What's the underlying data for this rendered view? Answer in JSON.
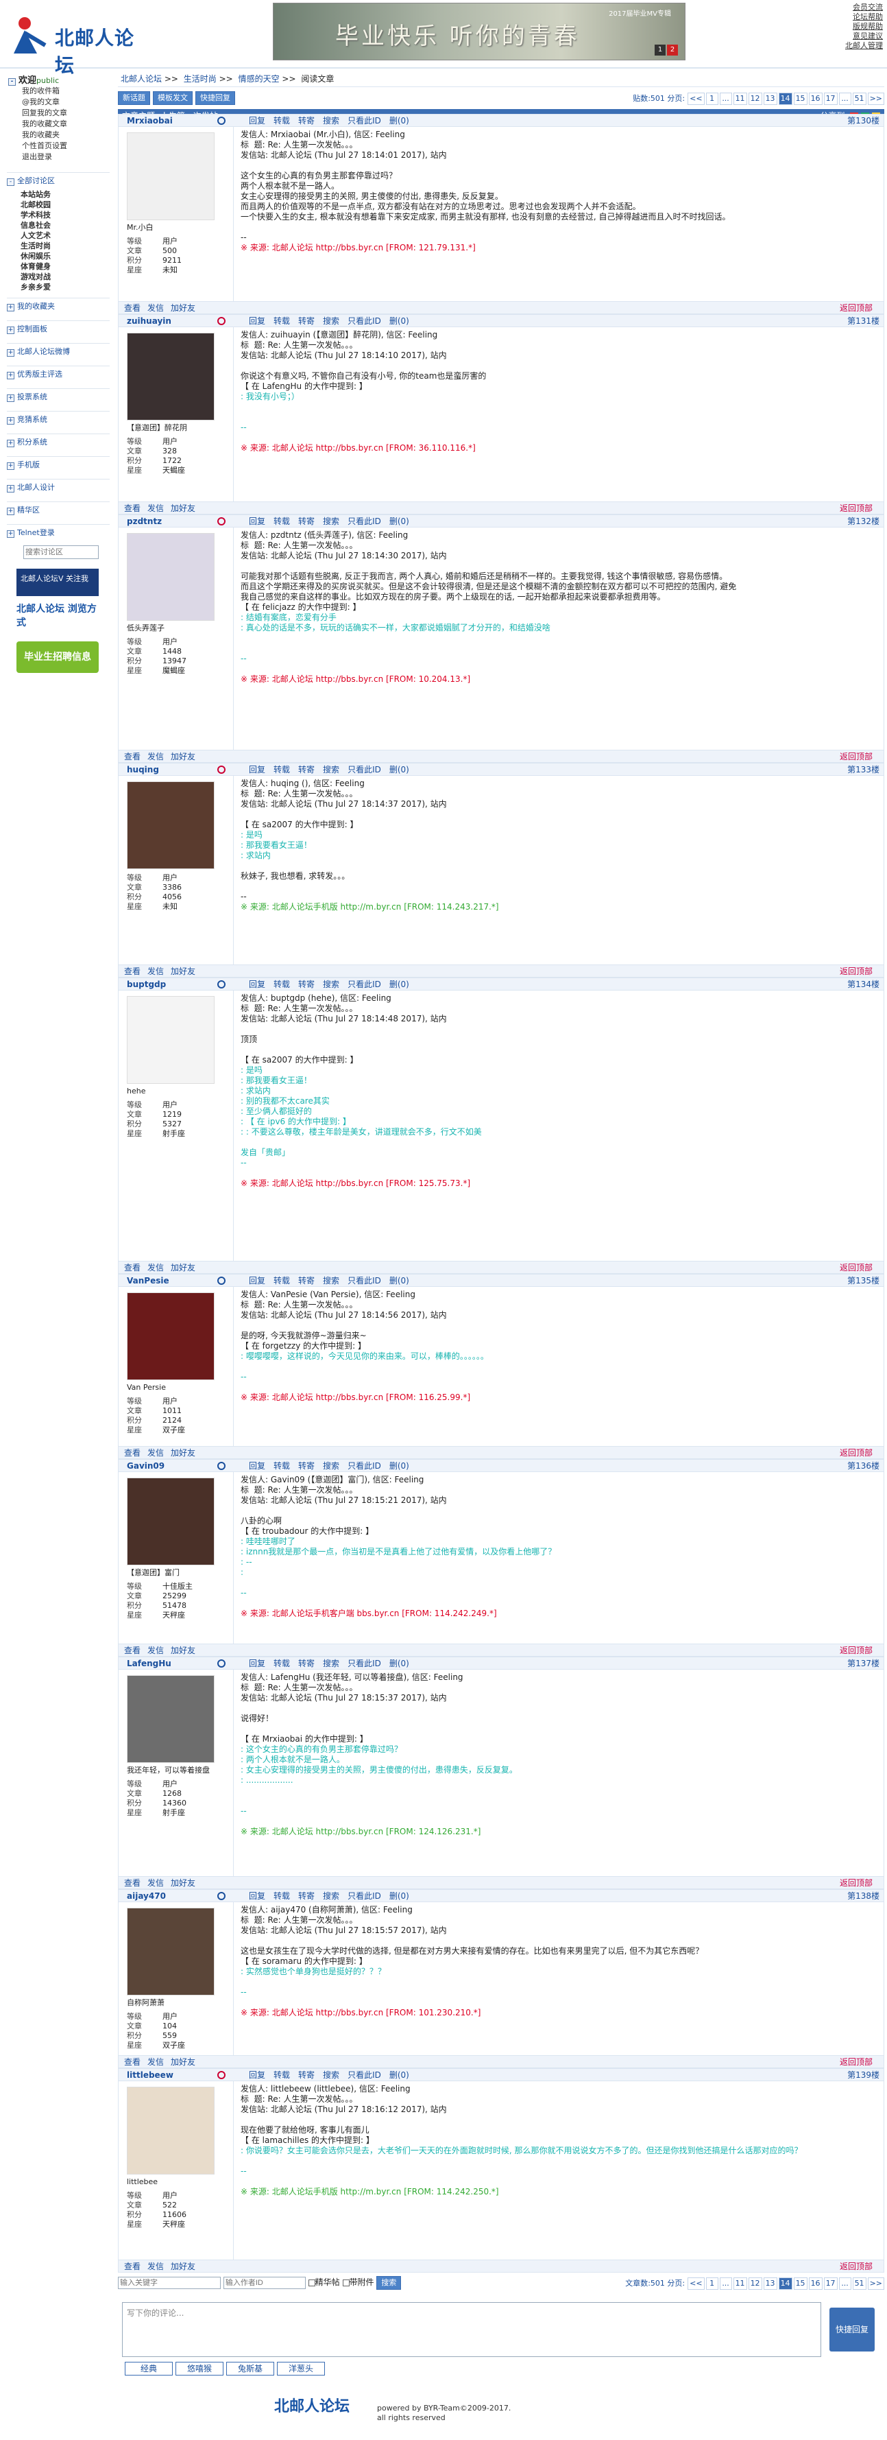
{
  "site": {
    "logo": "北邮人论坛",
    "banner_slogan": "毕业快乐 听你的青春",
    "banner_sub": "2017届毕业MV专辑",
    "banner_pages": [
      "1",
      "2"
    ]
  },
  "toplinks": [
    "会员交流",
    "论坛帮助",
    "版规帮助",
    "意见建议",
    "北邮人管理"
  ],
  "sidebar": {
    "welcome": "欢迎",
    "user": "public",
    "user_links": [
      "我的收件箱",
      "@我的文章",
      "回复我的文章",
      "我的收藏文章",
      "我的收藏夹",
      "个性首页设置",
      "退出登录"
    ],
    "all_sections": "全部讨论区",
    "boards": [
      "本站站务",
      "北邮校园",
      "学术科技",
      "信息社会",
      "人文艺术",
      "生活时尚",
      "休闲娱乐",
      "体育健身",
      "游戏对战",
      "乡亲乡爱"
    ],
    "sections": [
      "我的收藏夹",
      "控制面板",
      "北邮人论坛微博",
      "优秀版主评选",
      "投票系统",
      "竞猜系统",
      "积分系统",
      "手机版",
      "北邮人设计",
      "精华区",
      "Telnet登录"
    ],
    "search_placeholder": "搜索讨论区",
    "ad1": "北邮人论坛V 关注我",
    "ad2": "北邮人论坛 浏览方式",
    "ad3": "毕业生招聘信息"
  },
  "crumb": [
    "北邮人论坛",
    ">>",
    "生活时尚",
    ">>",
    "情感的天空",
    ">>",
    "阅读文章"
  ],
  "toolbar": {
    "new": "新话题",
    "mode": "模板发文",
    "quick": "快捷回复",
    "count_label": "贴数:501  分页:"
  },
  "pager": [
    "<<",
    "1",
    "...",
    "11",
    "12",
    "13",
    "14",
    "15",
    "16",
    "17",
    "...",
    "51",
    ">>"
  ],
  "pager_current": "14",
  "topic": {
    "label": "文章主题: 人生第一次发帖。。。",
    "share": "分享到:"
  },
  "actions": [
    "回复",
    "转载",
    "转寄",
    "搜索",
    "只看此ID",
    "删(0)"
  ],
  "foot_actions": [
    "查看",
    "发信",
    "加好友"
  ],
  "foot_top": "返回顶部",
  "posts": [
    {
      "user": "Mrxiaobai",
      "gender": "m",
      "floor": "第130楼",
      "title": "Mr.小白",
      "stats": [
        [
          "等级",
          "用户"
        ],
        [
          "文章",
          "500"
        ],
        [
          "积分",
          "9211"
        ],
        [
          "星座",
          "未知"
        ]
      ],
      "body": [
        [
          "",
          "发信人: Mrxiaobai (Mr.小白), 信区: Feeling\n标  题: Re: 人生第一次发帖。。。\n发信站: 北邮人论坛 (Thu Jul 27 18:14:01 2017), 站内\n\n这个女生的心真的有负男主那套停靠过吗？\n两个人根本就不是一路人。\n女主心安理得的接受男主的关照, 男主傻傻的付出, 患得患失, 反反复复。\n而且两人的价值观等的不是一点半点, 双方都没有站在对方的立场思考过。思考过也会发现两个人并不会适配。\n一个快要入生的女主, 根本就没有想着靠下来安定成家, 而男主就没有那样, 也没有刻意的去经营过, 自己掉得越进而且入时不时找回话。\n\n--\n"
        ],
        [
          "src",
          "※ 来源: 北邮人论坛 http://bbs.byr.cn [FROM: 121.79.131.*]"
        ]
      ]
    },
    {
      "user": "zuihuayin",
      "gender": "f",
      "floor": "第131楼",
      "title": "【意迦团】醉花阴",
      "stats": [
        [
          "等级",
          "用户"
        ],
        [
          "文章",
          "328"
        ],
        [
          "积分",
          "1722"
        ],
        [
          "星座",
          "天蝎座"
        ]
      ],
      "body": [
        [
          "",
          "发信人: zuihuayin (【意迦团】醉花阴), 信区: Feeling\n标  题: Re: 人生第一次发帖。。。\n发信站: 北邮人论坛 (Thu Jul 27 18:14:10 2017), 站内\n\n你说这个有意义吗, 不管你自己有没有小号, 你的team也是蛮厉害的\n【 在 LafengHu 的大作中提到: 】\n"
        ],
        [
          "q",
          ": 我没有小号；）\n\n\n--\n\n"
        ],
        [
          "src",
          "※ 来源: 北邮人论坛 http://bbs.byr.cn [FROM: 36.110.116.*]"
        ]
      ]
    },
    {
      "user": "pzdtntz",
      "gender": "f",
      "floor": "第132楼",
      "title": "低头弄莲子",
      "stats": [
        [
          "等级",
          "用户"
        ],
        [
          "文章",
          "1448"
        ],
        [
          "积分",
          "13947"
        ],
        [
          "星座",
          "魔蝎座"
        ]
      ],
      "body": [
        [
          "",
          "发信人: pzdtntz (低头弄莲子), 信区: Feeling\n标  题: Re: 人生第一次发帖。。。\n发信站: 北邮人论坛 (Thu Jul 27 18:14:30 2017), 站内\n\n可能我对那个话题有些脱离, 反正于我而言, 两个人真心, 婚前和婚后还是稍稍不一样的。主要我觉得, 钱这个事情很敏感, 容易伤感情。\n而且这个学期还来得及的买房说买就买。但是这不会计较得很清, 但是还是这个模糊不清的金额控制在双方都可以不可把控的范围内, 避免\n我自己感觉的来自这样的事业。比如双方现在的房子要。两个上级现在的话, 一起开始都承担起来说要都承担费用等。\n【 在 felicjazz 的大作中提到: 】\n"
        ],
        [
          "q",
          ": 结婚有案底，恋爱有分手\n: 真心处的话是不多，玩玩的话确实不一样，大家都说婚姻腻了才分开的，和结婚没啥\n\n\n--\n\n"
        ],
        [
          "src",
          "※ 来源: 北邮人论坛 http://bbs.byr.cn [FROM: 10.204.13.*]"
        ]
      ]
    },
    {
      "user": "huqing",
      "gender": "f",
      "floor": "第133楼",
      "title": "",
      "stats": [
        [
          "等级",
          "用户"
        ],
        [
          "文章",
          "3386"
        ],
        [
          "积分",
          "4056"
        ],
        [
          "星座",
          "未知"
        ]
      ],
      "body": [
        [
          "",
          "发信人: huqing (), 信区: Feeling\n标  题: Re: 人生第一次发帖。。。\n发信站: 北邮人论坛 (Thu Jul 27 18:14:37 2017), 站内\n\n【 在 sa2007 的大作中提到: 】\n"
        ],
        [
          "q",
          ": 是吗\n: 那我要看女王逼！\n: 求站内\n\n"
        ],
        [
          "",
          "秋妹子, 我也想看, 求转发。。。\n\n--\n"
        ],
        [
          "src g",
          "※ 来源: 北邮人论坛手机版 http://m.byr.cn [FROM: 114.243.217.*]"
        ]
      ]
    },
    {
      "user": "buptgdp",
      "gender": "m",
      "floor": "第134楼",
      "title": "hehe",
      "stats": [
        [
          "等级",
          "用户"
        ],
        [
          "文章",
          "1219"
        ],
        [
          "积分",
          "5327"
        ],
        [
          "星座",
          "射手座"
        ]
      ],
      "body": [
        [
          "",
          "发信人: buptgdp (hehe), 信区: Feeling\n标  题: Re: 人生第一次发帖。。。\n发信站: 北邮人论坛 (Thu Jul 27 18:14:48 2017), 站内\n\n顶顶\n\n【 在 sa2007 的大作中提到: 】\n"
        ],
        [
          "q",
          ": 是吗\n: 那我要看女王逼！\n: 求站内\n: 别的我都不太care其实\n: 至少俩人都挺好的\n: 【 在 ipv6 的大作中提到: 】\n: : 不要这么尊敬，楼主年龄是美女，讲道理就会不多，行文不如美\n\n"
        ],
        [
          "q",
          "发自「贵邮」\n--\n\n"
        ],
        [
          "src",
          "※ 来源: 北邮人论坛 http://bbs.byr.cn [FROM: 125.75.73.*]"
        ]
      ]
    },
    {
      "user": "VanPesie",
      "gender": "m",
      "floor": "第135楼",
      "title": "Van Persie",
      "stats": [
        [
          "等级",
          "用户"
        ],
        [
          "文章",
          "1011"
        ],
        [
          "积分",
          "2124"
        ],
        [
          "星座",
          "双子座"
        ]
      ],
      "body": [
        [
          "",
          "发信人: VanPesie (Van Persie), 信区: Feeling\n标  题: Re: 人生第一次发帖。。。\n发信站: 北邮人论坛 (Thu Jul 27 18:14:56 2017), 站内\n\n是的呀, 今天我就游停~游量归来~\n【 在 forgetzzy 的大作中提到: 】\n"
        ],
        [
          "q",
          ": 嘤嘤嘤嘤，这样说的，今天见见你的来由来。可以，棒棒的。。。。。。\n\n--\n\n"
        ],
        [
          "src",
          "※ 来源: 北邮人论坛 http://bbs.byr.cn [FROM: 116.25.99.*]"
        ]
      ]
    },
    {
      "user": "Gavin09",
      "gender": "m",
      "floor": "第136楼",
      "title": "【意迦团】富门",
      "stats": [
        [
          "等级",
          "十佳版主"
        ],
        [
          "文章",
          "25299"
        ],
        [
          "积分",
          "51478"
        ],
        [
          "星座",
          "天秤座"
        ]
      ],
      "body": [
        [
          "",
          "发信人: Gavin09 (【意迦团】富门), 信区: Feeling\n标  题: Re: 人生第一次发帖。。。\n发信站: 北邮人论坛 (Thu Jul 27 18:15:21 2017), 站内\n\n八卦的心啊\n【 在 troubadour 的大作中提到: 】\n"
        ],
        [
          "q",
          ": 哇哇哇哪时了\n: iznnn我就是那个最一点，你当初是不是真看上他了过他有爱情，以及你看上他哪了？\n: --\n:\n\n--\n\n"
        ],
        [
          "src",
          "※ 来源: 北邮人论坛手机客户端 bbs.byr.cn [FROM: 114.242.249.*]"
        ]
      ]
    },
    {
      "user": "LafengHu",
      "gender": "m",
      "floor": "第137楼",
      "title": "我还年轻，可以等着接盘",
      "stats": [
        [
          "等级",
          "用户"
        ],
        [
          "文章",
          "1268"
        ],
        [
          "积分",
          "14360"
        ],
        [
          "星座",
          "射手座"
        ]
      ],
      "body": [
        [
          "",
          "发信人: LafengHu (我还年轻, 可以等着接盘), 信区: Feeling\n标  题: Re: 人生第一次发帖。。。\n发信站: 北邮人论坛 (Thu Jul 27 18:15:37 2017), 站内\n\n说得好！\n\n【 在 Mrxiaobai 的大作中提到: 】\n"
        ],
        [
          "q",
          ": 这个女主的心真的有负男主那套停靠过吗？\n: 两个人根本就不是一路人。\n: 女主心安理得的接受男主的关照，男主傻傻的付出，患得患失，反反复复。\n: ..................\n\n\n--\n\n"
        ],
        [
          "src g",
          "※ 来源: 北邮人论坛 http://bbs.byr.cn [FROM: 124.126.231.*]"
        ]
      ]
    },
    {
      "user": "aijay470",
      "gender": "m",
      "floor": "第138楼",
      "title": "自称阿萧萧",
      "stats": [
        [
          "等级",
          "用户"
        ],
        [
          "文章",
          "104"
        ],
        [
          "积分",
          "559"
        ],
        [
          "星座",
          "双子座"
        ]
      ],
      "body": [
        [
          "",
          "发信人: aijay470 (自称阿萧萧), 信区: Feeling\n标  题: Re: 人生第一次发帖。。。\n发信站: 北邮人论坛 (Thu Jul 27 18:15:57 2017), 站内\n\n这也是女孩生在了现今大学时代做的选择, 但是都在对方男大来接有爱情的存在。比如也有来男里完了以后, 但不为其它东西呢？\n【 在 soramaru 的大作中提到: 】\n"
        ],
        [
          "q",
          ": 实然感觉也个单身狗也是挺好的？？？\n\n--\n\n"
        ],
        [
          "src",
          "※ 来源: 北邮人论坛 http://bbs.byr.cn [FROM: 101.230.210.*]"
        ]
      ]
    },
    {
      "user": "littlebeew",
      "gender": "f",
      "floor": "第139楼",
      "title": "littlebee",
      "stats": [
        [
          "等级",
          "用户"
        ],
        [
          "文章",
          "522"
        ],
        [
          "积分",
          "11606"
        ],
        [
          "星座",
          "天秤座"
        ]
      ],
      "body": [
        [
          "",
          "发信人: littlebeew (littlebee), 信区: Feeling\n标  题: Re: 人生第一次发帖。。。\n发信站: 北邮人论坛 (Thu Jul 27 18:16:12 2017), 站内\n\n现在他要了就给他呀, 客事儿有面儿\n【 在 lamachilles 的大作中提到: 】\n"
        ],
        [
          "q",
          ": 你说要吗？女主可能会选你只是去，大老爷们一天天的在外面跑就时时候, 那么那你就不用说说女方不多了的。但还是你找到他还搞是什么话那对应的吗？\n\n--\n\n"
        ],
        [
          "src g",
          "※ 来源: 北邮人论坛手机版 http://m.byr.cn [FROM: 114.242.250.*]"
        ]
      ]
    }
  ],
  "bottom": {
    "author_placeholder": "输入关键字",
    "author2_placeholder": "输入作者ID",
    "c1": "精华帖",
    "c2": "带附件",
    "search": "搜索",
    "count": "文章数:501  分页:"
  },
  "reply": {
    "placeholder": "写下你的评论...",
    "button": "快捷回复",
    "faces": [
      "经典",
      "悠嘻猴",
      "兔斯基",
      "洋葱头"
    ]
  },
  "footer": {
    "logo": "北邮人论坛",
    "line1": "powered by BYR-Team©2009-2017.",
    "line2": "all rights reserved"
  }
}
